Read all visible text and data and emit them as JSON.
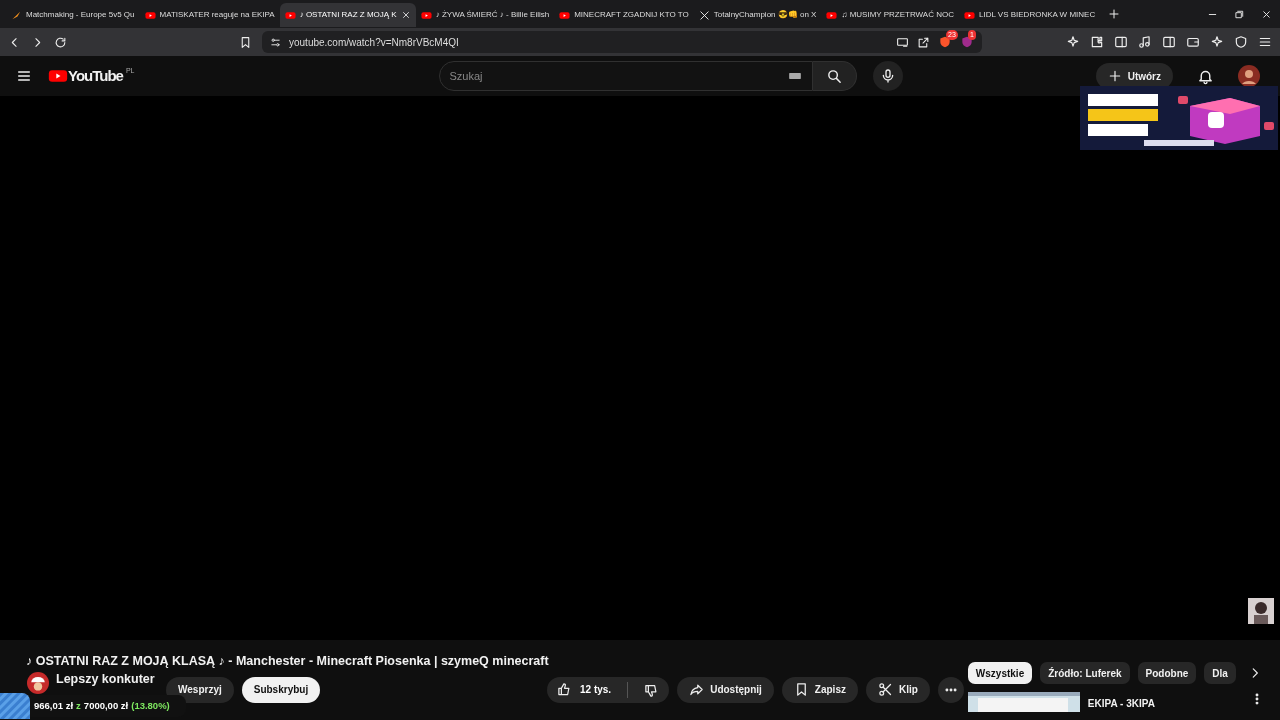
{
  "browser_tabs": [
    {
      "title": "Matchmaking - Europe 5v5 Qu",
      "kind": "game",
      "selected": false
    },
    {
      "title": "MATISKATER reaguje na EKIPA",
      "kind": "youtube",
      "selected": false
    },
    {
      "title": "♪ OSTATNI RAZ Z MOJĄ K",
      "kind": "youtube",
      "selected": true
    },
    {
      "title": "♪ ŻYWA ŚMIERĆ ♪ - Billie Eilish",
      "kind": "youtube",
      "selected": false
    },
    {
      "title": "MINECRAFT ZGADNIJ KTO TO",
      "kind": "youtube",
      "selected": false
    },
    {
      "title": "TotalnyChampion 😎👊 on X",
      "kind": "x",
      "selected": false
    },
    {
      "title": "♫ MUSIMY PRZETRWAĆ NOC",
      "kind": "youtube",
      "selected": false
    },
    {
      "title": "LIDL VS BIEDRONKA W MINEC",
      "kind": "youtube",
      "selected": false
    }
  ],
  "address": "youtube.com/watch?v=Nm8rVBcM4QI",
  "extension_badges": {
    "shield": "23",
    "rewards": "1"
  },
  "youtube_header": {
    "logo": "YouTube",
    "region": "PL",
    "search_placeholder": "Szukaj",
    "create_label": "Utwórz"
  },
  "video": {
    "title": "♪ OSTATNI RAZ Z MOJĄ KLASĄ ♪ - Manchester - Minecraft Piosenka | szymeQ minecraft",
    "overlay_label": "Lepszy konkuter",
    "goal": {
      "raised": "966,01 zł",
      "sep": "z",
      "target": "7000,00 zł",
      "percent": "(13.80%)"
    },
    "support_label": "Wesprzyj",
    "subscribe_label": "Subskrybuj",
    "likes": "12 tys.",
    "share_label": "Udostępnij",
    "save_label": "Zapisz",
    "clip_label": "Klip"
  },
  "chips": [
    {
      "label": "Wszystkie",
      "selected": true
    },
    {
      "label": "Źródło: Luferek",
      "selected": false
    },
    {
      "label": "Podobne",
      "selected": false
    },
    {
      "label": "Dla",
      "selected": false
    }
  ],
  "recommended": [
    {
      "title": "EKIPA - 3KIPA"
    }
  ]
}
